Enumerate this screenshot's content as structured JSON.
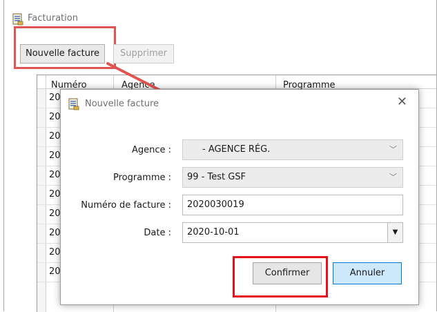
{
  "main_window": {
    "title": "Facturation",
    "toolbar": {
      "new_label": "Nouvelle facture",
      "delete_label": "Supprimer"
    },
    "grid": {
      "columns": [
        "Numéro",
        "Agence",
        "Programme"
      ],
      "rows": [
        "202",
        "202",
        "202",
        "202",
        "202",
        "202",
        "202",
        "202",
        "202",
        "202"
      ]
    }
  },
  "dialog": {
    "title": "Nouvelle facture",
    "agence_label": "Agence :",
    "agence_value": "- AGENCE RÉG.",
    "programme_label": "Programme :",
    "programme_value": "99 - Test GSF",
    "numero_label": "Numéro de facture :",
    "numero_value": "2020030019",
    "date_label": "Date :",
    "date_value": "2020-10-01",
    "confirm_label": "Confirmer",
    "cancel_label": "Annuler"
  },
  "colors": {
    "highlight": "#e05454",
    "highlight_strong": "#e8111a",
    "primary_button_bg": "#cde8fa",
    "primary_button_border": "#0078d4"
  },
  "icons": {
    "app": "document-list-icon",
    "close": "close-icon",
    "combo_arrow": "chevron-down-icon",
    "arrow": "annotation-arrow-icon"
  }
}
